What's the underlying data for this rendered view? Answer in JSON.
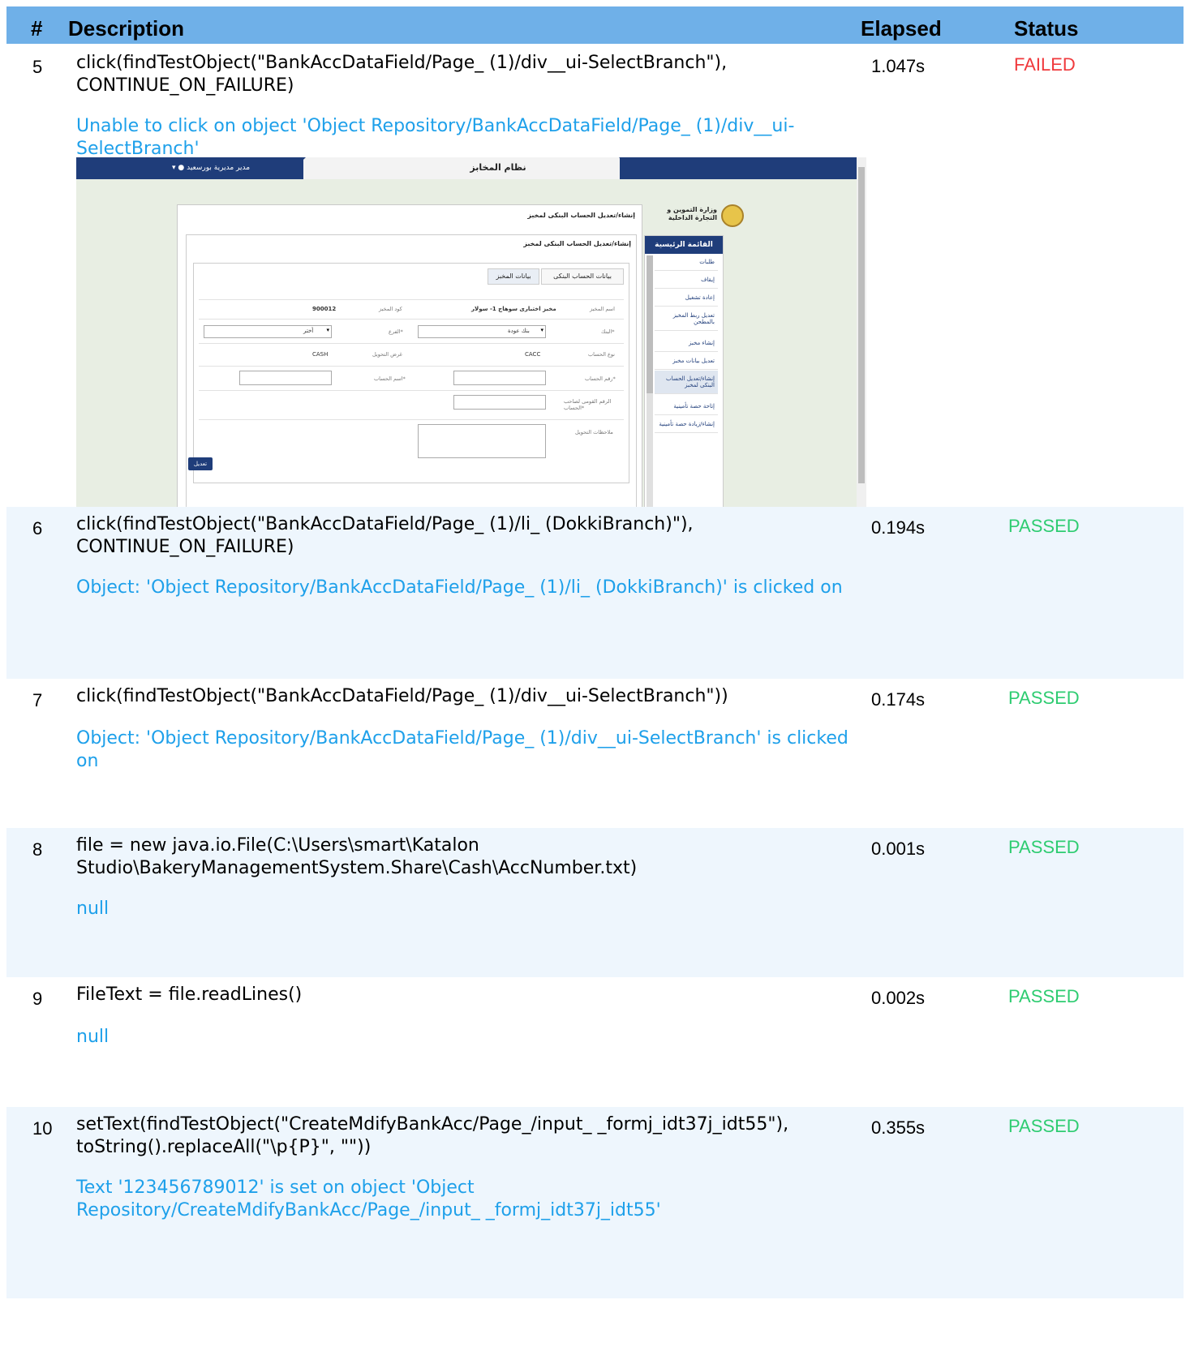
{
  "header": {
    "num": "#",
    "description": "Description",
    "elapsed": "Elapsed",
    "status": "Status"
  },
  "rows": [
    {
      "num": "5",
      "desc": "click(findTestObject(\"BankAccDataField/Page_ (1)/div__ui-SelectBranch\"), CONTINUE_ON_FAILURE)",
      "msg": "Unable to click on object 'Object Repository/BankAccDataField/Page_ (1)/div__ui-SelectBranch'",
      "elapsed": "1.047s",
      "status": "FAILED"
    },
    {
      "num": "6",
      "desc": "click(findTestObject(\"BankAccDataField/Page_ (1)/li_ (DokkiBranch)\"), CONTINUE_ON_FAILURE)",
      "msg": "Object: 'Object Repository/BankAccDataField/Page_ (1)/li_ (DokkiBranch)' is clicked on",
      "elapsed": "0.194s",
      "status": "PASSED"
    },
    {
      "num": "7",
      "desc": "click(findTestObject(\"BankAccDataField/Page_ (1)/div__ui-SelectBranch\"))",
      "msg": "Object: 'Object Repository/BankAccDataField/Page_ (1)/div__ui-SelectBranch' is clicked on",
      "elapsed": "0.174s",
      "status": "PASSED"
    },
    {
      "num": "8",
      "desc": "file = new java.io.File(C:\\Users\\smart\\Katalon Studio\\BakeryManagementSystem.Share\\Cash\\AccNumber.txt)",
      "msg": "null",
      "elapsed": "0.001s",
      "status": "PASSED"
    },
    {
      "num": "9",
      "desc": "FileText = file.readLines()",
      "msg": "null",
      "elapsed": "0.002s",
      "status": "PASSED"
    },
    {
      "num": "10",
      "desc": "setText(findTestObject(\"CreateMdifyBankAcc/Page_/input_ _formj_idt37j_idt55\"), toString().replaceAll(\"\\p{P}\", \"\"))",
      "msg": "Text '123456789012' is set on object 'Object Repository/CreateMdifyBankAcc/Page_/input_ _formj_idt37j_idt55'",
      "elapsed": "0.355s",
      "status": "PASSED"
    }
  ],
  "screenshot": {
    "system_title": "نظام المخابز",
    "user": "مدير مديرية بورسعيد",
    "ministry": "وزارة التموين و التجارة الداخلية",
    "menu_title": "القائمة الرئيسية",
    "menu_items": [
      "طلبات",
      "إيقاف",
      "إعادة تشغيل",
      "تعديل ربط المخبز بالمطحن",
      "إنشاء مخبز",
      "تعديل بيانات مخبز",
      "إنشاء/تعديل الحساب البنكى لمخبز",
      "إتاحة حصة تأمينية",
      "إنشاء/زيادة حصة تأمينية"
    ],
    "panel_title": "إنشاء/تعديل الحساب البنكى لمخبز",
    "inner_title": "إنشاء/تعديل الحساب البنكى لمخبز",
    "tab_bank": "بيانات الحساب البنكى",
    "tab_bakery": "بيانات المخبز",
    "fields": {
      "bakery_name_label": "اسم المخبز",
      "bakery_name": "مخبز اختبارى سوهاج 1- سولار",
      "bakery_code_label": "كود المخبز",
      "bakery_code": "900012",
      "bank_label": "البنك*",
      "bank": "بنك عودة",
      "branch_label": "الفرع*",
      "branch": "أختر",
      "account_type_label": "نوع الحساب",
      "account_type": "CACC",
      "transfer_purpose_label": "غرض التحويل",
      "transfer_purpose": "CASH",
      "account_number_label": "رقم الحساب*",
      "account_name_label": "اسم الحساب*",
      "national_id_label": "الرقم القومى لصاحب الحساب*",
      "notes_label": "ملاحظات التحويل"
    },
    "submit": "تعديل"
  }
}
